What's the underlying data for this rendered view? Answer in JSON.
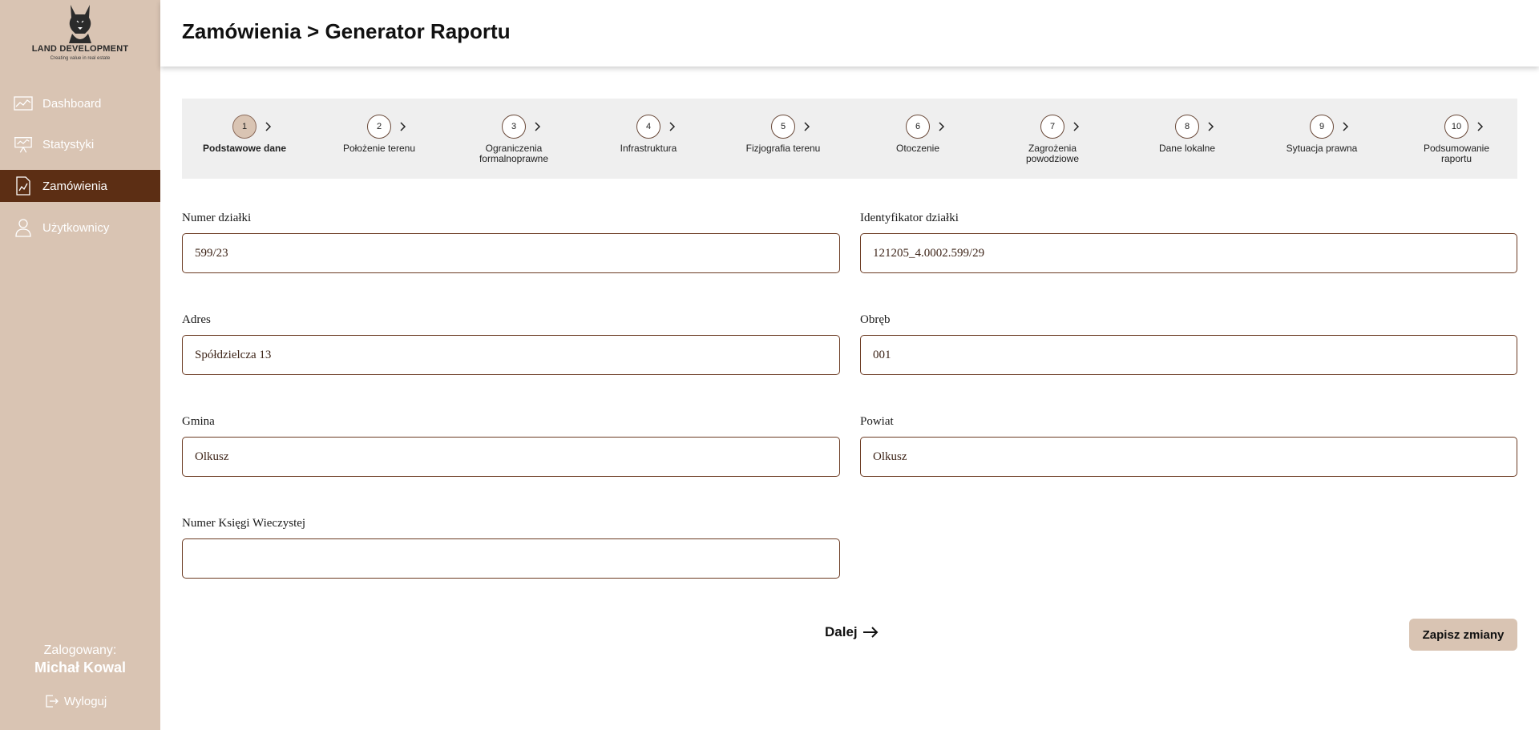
{
  "sidebar": {
    "logo": {
      "title": "LAND DEVELOPMENT",
      "subtitle": "Creating value in real estate",
      "icon": "dog-logo-icon"
    },
    "items": [
      {
        "label": "Dashboard",
        "icon": "line-chart-icon",
        "active": false
      },
      {
        "label": "Statystyki",
        "icon": "presentation-board-icon",
        "active": false
      },
      {
        "label": "Zamówienia",
        "icon": "document-chart-icon",
        "active": true
      },
      {
        "label": "Użytkownicy",
        "icon": "user-icon",
        "active": false
      }
    ],
    "logged_label": "Zalogowany:",
    "logged_user": "Michał Kowal",
    "logout_label": "Wyloguj"
  },
  "header": {
    "title": "Zamówienia > Generator Raportu"
  },
  "stepper": {
    "steps": [
      {
        "number": "1",
        "label": "Podstawowe dane",
        "active": true
      },
      {
        "number": "2",
        "label": "Położenie terenu",
        "active": false
      },
      {
        "number": "3",
        "label": "Ograniczenia formalnoprawne",
        "active": false
      },
      {
        "number": "4",
        "label": "Infrastruktura",
        "active": false
      },
      {
        "number": "5",
        "label": "Fizjografia terenu",
        "active": false
      },
      {
        "number": "6",
        "label": "Otoczenie",
        "active": false
      },
      {
        "number": "7",
        "label": "Zagrożenia powodziowe",
        "active": false
      },
      {
        "number": "8",
        "label": "Dane lokalne",
        "active": false
      },
      {
        "number": "9",
        "label": "Sytuacja prawna",
        "active": false
      },
      {
        "number": "10",
        "label": "Podsumowanie raportu",
        "active": false
      }
    ]
  },
  "form": {
    "numer_dzialki": {
      "label": "Numer działki",
      "value": "599/23"
    },
    "identyfikator": {
      "label": "Identyfikator działki",
      "value": "121205_4.0002.599/29"
    },
    "adres": {
      "label": "Adres",
      "value": "Spółdzielcza 13"
    },
    "obreb": {
      "label": "Obręb",
      "value": "001"
    },
    "gmina": {
      "label": "Gmina",
      "value": "Olkusz"
    },
    "powiat": {
      "label": "Powiat",
      "value": "Olkusz"
    },
    "ksiega": {
      "label": "Numer Księgi Wieczystej",
      "value": ""
    }
  },
  "actions": {
    "next_label": "Dalej",
    "save_label": "Zapisz zmiany"
  },
  "colors": {
    "sidebar_bg": "#d9c4b3",
    "active_nav": "#5c2e14",
    "input_border": "#6b3a22",
    "stepper_bg": "#efefef"
  }
}
